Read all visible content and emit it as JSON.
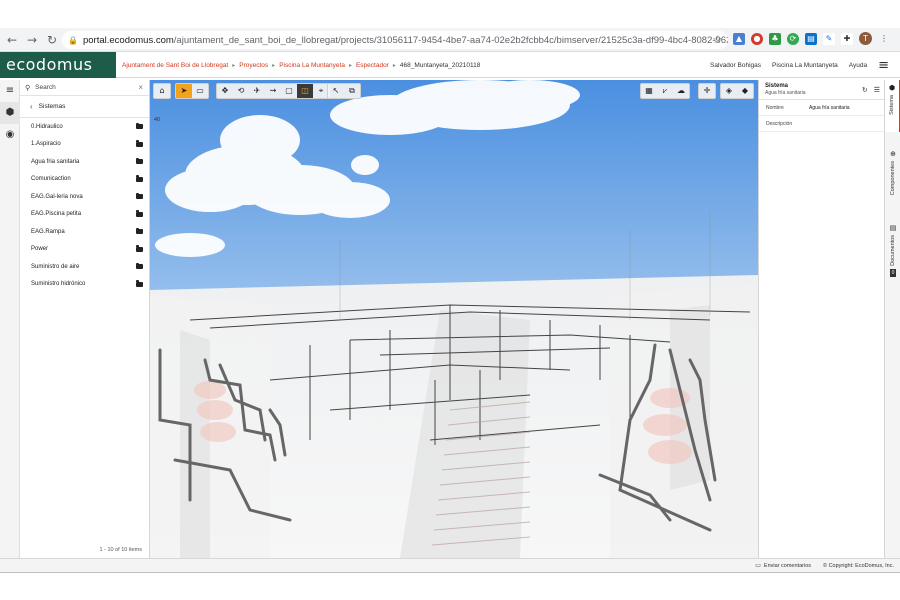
{
  "browser": {
    "url_domain": "portal.ecodomus.com",
    "url_path": "/ajuntament_de_sant_boi_de_llobregat/projects/31056117-9454-4be7-aa74-02e2b2fcbb4c/bimserver/21525c3a-df99-4bc4-8082-96245efa3dd07eleme...",
    "profile_initial": "T"
  },
  "header": {
    "logo": "ecodomus",
    "breadcrumbs": [
      "Ajuntament de Sant Boi de Llobregat",
      "Proyectos",
      "Piscina La Muntanyeta",
      "Espectador",
      "468_Muntanyeta_20210118"
    ],
    "user": "Salvador Bohigas",
    "project": "Piscina La Muntanyeta",
    "help": "Ayuda"
  },
  "left_panel": {
    "search_placeholder": "Search",
    "title": "Sistemas",
    "items": [
      {
        "label": "0.Hidraulico"
      },
      {
        "label": "1.Aspiracio"
      },
      {
        "label": "Agua fria sanitaria"
      },
      {
        "label": "Comunicaction"
      },
      {
        "label": "EAG.Gal-leria nova"
      },
      {
        "label": "EAG.Piscina petita"
      },
      {
        "label": "EAG.Rampa"
      },
      {
        "label": "Power"
      },
      {
        "label": "Suministro de aire"
      },
      {
        "label": "Suministro hidrónico"
      }
    ],
    "count_text": "1 - 10 of 10 items"
  },
  "viewer": {
    "view_number": "40"
  },
  "properties": {
    "title": "Sistema",
    "subtitle": "Agua fría sanitaria",
    "rows": [
      {
        "key": "Nombre",
        "value": "Agua fría sanitaria"
      },
      {
        "key": "Descripción",
        "value": ""
      }
    ]
  },
  "right_tabs": {
    "sistema": "Sistema",
    "componentes": "Componentes",
    "documentos": "Documentos"
  },
  "footer": {
    "feedback": "Enviar comentarios",
    "copyright": "© Copyright: EcoDomus, Inc."
  },
  "colors": {
    "brand": "#1c5c49",
    "breadcrumb": "#d1381c",
    "tool_active": "#f2a31b"
  }
}
